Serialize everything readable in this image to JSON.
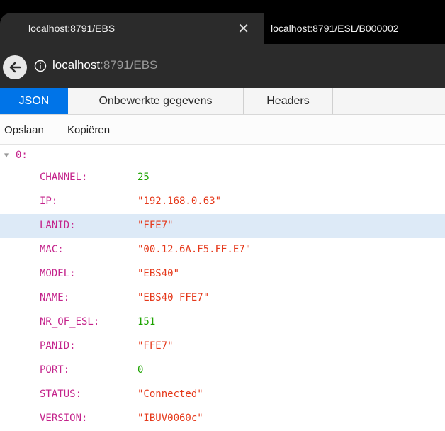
{
  "tabs": [
    {
      "title": "localhost:8791/EBS",
      "active": true
    },
    {
      "title": "localhost:8791/ESL/B000002",
      "active": false
    }
  ],
  "address": {
    "host": "localhost",
    "rest": ":8791/EBS"
  },
  "viewer": {
    "tabs": [
      "JSON",
      "Onbewerkte gegevens",
      "Headers"
    ],
    "actions": {
      "save": "Opslaan",
      "copy": "Kopiëren"
    }
  },
  "tree": {
    "root_key": "0:",
    "rows": [
      {
        "key": "CHANNEL:",
        "value": "25",
        "type": "number"
      },
      {
        "key": "IP:",
        "value": "\"192.168.0.63\"",
        "type": "string"
      },
      {
        "key": "LANID:",
        "value": "\"FFE7\"",
        "type": "string",
        "highlighted": true
      },
      {
        "key": "MAC:",
        "value": "\"00.12.6A.F5.FF.E7\"",
        "type": "string"
      },
      {
        "key": "MODEL:",
        "value": "\"EBS40\"",
        "type": "string"
      },
      {
        "key": "NAME:",
        "value": "\"EBS40_FFE7\"",
        "type": "string"
      },
      {
        "key": "NR_OF_ESL:",
        "value": "151",
        "type": "number"
      },
      {
        "key": "PANID:",
        "value": "\"FFE7\"",
        "type": "string"
      },
      {
        "key": "PORT:",
        "value": "0",
        "type": "number"
      },
      {
        "key": "STATUS:",
        "value": "\"Connected\"",
        "type": "string"
      },
      {
        "key": "VERSION:",
        "value": "\"IBUV0060c\"",
        "type": "string"
      }
    ]
  },
  "colors": {
    "json_tab_active": "#0074e8",
    "key": "#c4238b",
    "string": "#e5391b",
    "number": "#1da300",
    "highlight_row": "#ddeaf7"
  }
}
